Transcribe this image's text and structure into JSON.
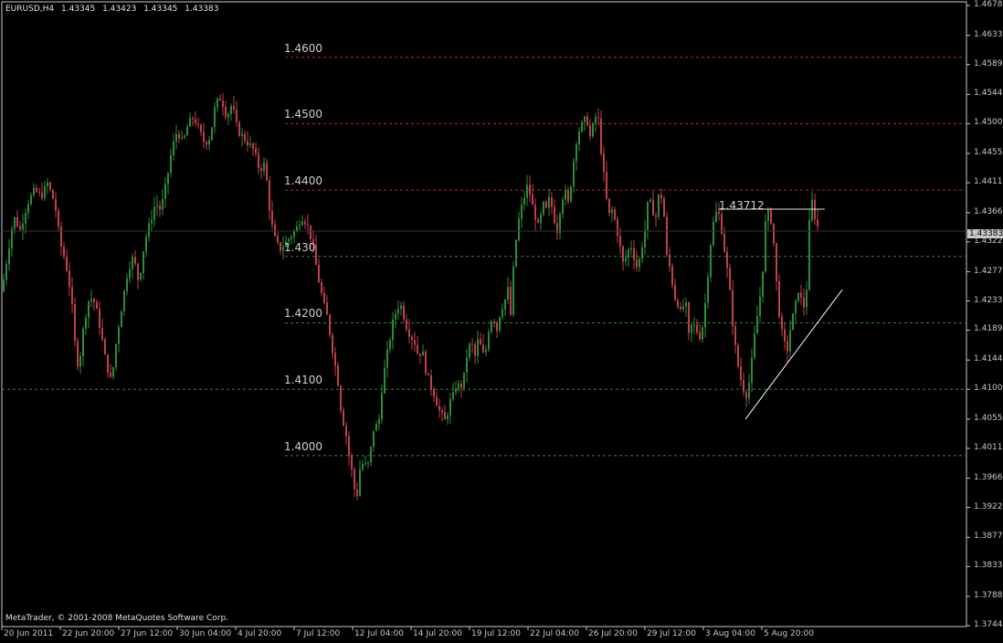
{
  "header": {
    "symbol": "EURUSD,H4",
    "open": "1.43345",
    "high": "1.43423",
    "low": "1.43345",
    "close": "1.43383"
  },
  "copyright": "MetaTrader, © 2001-2008 MetaQuotes Software Corp.",
  "current_price": "1.43383",
  "annotation_label": "1.43712",
  "colors": {
    "background": "#000000",
    "frame": "#c8c8c8",
    "bull": "#2e8b3a",
    "bear": "#c0404a",
    "red_level": "#b03030",
    "green_level": "#2e8b3a",
    "trendline": "#ffffff"
  },
  "chart_data": {
    "type": "candlestick",
    "title": "EURUSD,H4",
    "xlabel": "",
    "ylabel": "",
    "ylim": [
      1.3744,
      1.4678
    ],
    "y_ticks": [
      "1.46780",
      "1.46330",
      "1.45890",
      "1.45440",
      "1.45000",
      "1.44550",
      "1.44110",
      "1.43660",
      "1.43220",
      "1.42770",
      "1.42330",
      "1.41890",
      "1.41440",
      "1.41000",
      "1.40550",
      "1.40110",
      "1.39660",
      "1.39220",
      "1.38770",
      "1.38330",
      "1.37880",
      "1.37440"
    ],
    "x_ticks": [
      "20 Jun 2011",
      "22 Jun 20:00",
      "27 Jun 12:00",
      "30 Jun 04:00",
      "4 Jul 20:00",
      "7 Jul 12:00",
      "12 Jul 04:00",
      "14 Jul 20:00",
      "19 Jul 12:00",
      "22 Jul 04:00",
      "26 Jul 20:00",
      "29 Jul 12:00",
      "3 Aug 04:00",
      "5 Aug 20:00"
    ],
    "levels": [
      {
        "label": "1.4600",
        "value": 1.46,
        "color": "red"
      },
      {
        "label": "1.4500",
        "value": 1.45,
        "color": "red"
      },
      {
        "label": "1.4400",
        "value": 1.44,
        "color": "red"
      },
      {
        "label": "1.430",
        "value": 1.43,
        "color": "green"
      },
      {
        "label": "1.4200",
        "value": 1.42,
        "color": "green"
      },
      {
        "label": "1.4100",
        "value": 1.41,
        "color": "green"
      },
      {
        "label": "1.4000",
        "value": 1.4,
        "color": "green"
      }
    ],
    "grid": false,
    "close_path": [
      [
        0,
        1.423
      ],
      [
        8,
        1.43
      ],
      [
        15,
        1.436
      ],
      [
        22,
        1.434
      ],
      [
        30,
        1.438
      ],
      [
        38,
        1.44
      ],
      [
        45,
        1.439
      ],
      [
        52,
        1.441
      ],
      [
        60,
        1.438
      ],
      [
        66,
        1.432
      ],
      [
        72,
        1.429
      ],
      [
        78,
        1.424
      ],
      [
        82,
        1.417
      ],
      [
        86,
        1.413
      ],
      [
        92,
        1.42
      ],
      [
        98,
        1.424
      ],
      [
        104,
        1.423
      ],
      [
        110,
        1.419
      ],
      [
        116,
        1.414
      ],
      [
        122,
        1.411
      ],
      [
        128,
        1.418
      ],
      [
        134,
        1.423
      ],
      [
        140,
        1.428
      ],
      [
        146,
        1.43
      ],
      [
        152,
        1.426
      ],
      [
        158,
        1.432
      ],
      [
        164,
        1.435
      ],
      [
        170,
        1.438
      ],
      [
        176,
        1.437
      ],
      [
        182,
        1.441
      ],
      [
        188,
        1.446
      ],
      [
        194,
        1.449
      ],
      [
        200,
        1.447
      ],
      [
        206,
        1.45
      ],
      [
        212,
        1.451
      ],
      [
        218,
        1.449
      ],
      [
        224,
        1.447
      ],
      [
        230,
        1.448
      ],
      [
        236,
        1.453
      ],
      [
        242,
        1.454
      ],
      [
        248,
        1.451
      ],
      [
        254,
        1.453
      ],
      [
        260,
        1.449
      ],
      [
        266,
        1.448
      ],
      [
        272,
        1.447
      ],
      [
        278,
        1.446
      ],
      [
        284,
        1.443
      ],
      [
        290,
        1.444
      ],
      [
        296,
        1.436
      ],
      [
        300,
        1.433
      ],
      [
        306,
        1.431
      ],
      [
        312,
        1.432
      ],
      [
        318,
        1.433
      ],
      [
        324,
        1.434
      ],
      [
        330,
        1.436
      ],
      [
        336,
        1.435
      ],
      [
        342,
        1.432
      ],
      [
        348,
        1.427
      ],
      [
        354,
        1.423
      ],
      [
        358,
        1.421
      ],
      [
        364,
        1.416
      ],
      [
        370,
        1.411
      ],
      [
        374,
        1.406
      ],
      [
        378,
        1.404
      ],
      [
        382,
        1.4
      ],
      [
        386,
        1.397
      ],
      [
        390,
        1.393
      ],
      [
        394,
        1.398
      ],
      [
        398,
        1.399
      ],
      [
        402,
        1.398
      ],
      [
        406,
        1.401
      ],
      [
        410,
        1.405
      ],
      [
        414,
        1.404
      ],
      [
        418,
        1.41
      ],
      [
        422,
        1.414
      ],
      [
        426,
        1.417
      ],
      [
        430,
        1.42
      ],
      [
        434,
        1.422
      ],
      [
        438,
        1.423
      ],
      [
        442,
        1.421
      ],
      [
        446,
        1.419
      ],
      [
        450,
        1.418
      ],
      [
        454,
        1.417
      ],
      [
        458,
        1.415
      ],
      [
        462,
        1.416
      ],
      [
        466,
        1.413
      ],
      [
        470,
        1.411
      ],
      [
        476,
        1.409
      ],
      [
        480,
        1.407
      ],
      [
        484,
        1.406
      ],
      [
        488,
        1.405
      ],
      [
        492,
        1.408
      ],
      [
        496,
        1.409
      ],
      [
        500,
        1.411
      ],
      [
        504,
        1.41
      ],
      [
        508,
        1.412
      ],
      [
        512,
        1.416
      ],
      [
        516,
        1.417
      ],
      [
        520,
        1.415
      ],
      [
        524,
        1.418
      ],
      [
        528,
        1.415
      ],
      [
        532,
        1.416
      ],
      [
        536,
        1.42
      ],
      [
        540,
        1.421
      ],
      [
        544,
        1.419
      ],
      [
        548,
        1.422
      ],
      [
        552,
        1.423
      ],
      [
        556,
        1.425
      ],
      [
        560,
        1.42
      ],
      [
        562,
        1.428
      ],
      [
        566,
        1.434
      ],
      [
        570,
        1.437
      ],
      [
        574,
        1.439
      ],
      [
        578,
        1.441
      ],
      [
        582,
        1.438
      ],
      [
        586,
        1.436
      ],
      [
        590,
        1.434
      ],
      [
        594,
        1.438
      ],
      [
        598,
        1.437
      ],
      [
        602,
        1.439
      ],
      [
        606,
        1.436
      ],
      [
        610,
        1.434
      ],
      [
        614,
        1.438
      ],
      [
        618,
        1.44
      ],
      [
        622,
        1.438
      ],
      [
        626,
        1.442
      ],
      [
        630,
        1.447
      ],
      [
        634,
        1.449
      ],
      [
        638,
        1.45
      ],
      [
        642,
        1.451
      ],
      [
        646,
        1.448
      ],
      [
        650,
        1.45
      ],
      [
        654,
        1.452
      ],
      [
        658,
        1.446
      ],
      [
        662,
        1.441
      ],
      [
        666,
        1.436
      ],
      [
        670,
        1.437
      ],
      [
        674,
        1.435
      ],
      [
        678,
        1.432
      ],
      [
        682,
        1.429
      ],
      [
        686,
        1.43
      ],
      [
        690,
        1.432
      ],
      [
        694,
        1.43
      ],
      [
        698,
        1.428
      ],
      [
        702,
        1.431
      ],
      [
        706,
        1.434
      ],
      [
        710,
        1.439
      ],
      [
        714,
        1.437
      ],
      [
        718,
        1.436
      ],
      [
        722,
        1.44
      ],
      [
        726,
        1.438
      ],
      [
        730,
        1.43
      ],
      [
        734,
        1.428
      ],
      [
        738,
        1.424
      ],
      [
        742,
        1.423
      ],
      [
        746,
        1.421
      ],
      [
        750,
        1.424
      ],
      [
        754,
        1.418
      ],
      [
        758,
        1.42
      ],
      [
        762,
        1.419
      ],
      [
        766,
        1.418
      ],
      [
        770,
        1.42
      ],
      [
        774,
        1.426
      ],
      [
        778,
        1.432
      ],
      [
        782,
        1.436
      ],
      [
        786,
        1.437
      ],
      [
        790,
        1.434
      ],
      [
        794,
        1.43
      ],
      [
        798,
        1.426
      ],
      [
        802,
        1.42
      ],
      [
        806,
        1.415
      ],
      [
        810,
        1.412
      ],
      [
        814,
        1.41
      ],
      [
        818,
        1.409
      ],
      [
        822,
        1.413
      ],
      [
        826,
        1.418
      ],
      [
        830,
        1.422
      ],
      [
        834,
        1.426
      ],
      [
        838,
        1.435
      ],
      [
        842,
        1.437
      ],
      [
        846,
        1.434
      ],
      [
        850,
        1.426
      ],
      [
        854,
        1.42
      ],
      [
        858,
        1.417
      ],
      [
        862,
        1.416
      ],
      [
        866,
        1.42
      ],
      [
        870,
        1.422
      ],
      [
        874,
        1.425
      ],
      [
        878,
        1.423
      ],
      [
        882,
        1.422
      ],
      [
        886,
        1.435
      ],
      [
        888,
        1.439
      ],
      [
        892,
        1.436
      ],
      [
        896,
        1.434
      ],
      [
        900,
        1.4338
      ]
    ],
    "resistance_line": {
      "label": "1.43712",
      "value": 1.43712
    },
    "trendline": {
      "from": {
        "x": 816,
        "value": 1.4055
      },
      "to": {
        "x": 922,
        "value": 1.425
      }
    }
  }
}
